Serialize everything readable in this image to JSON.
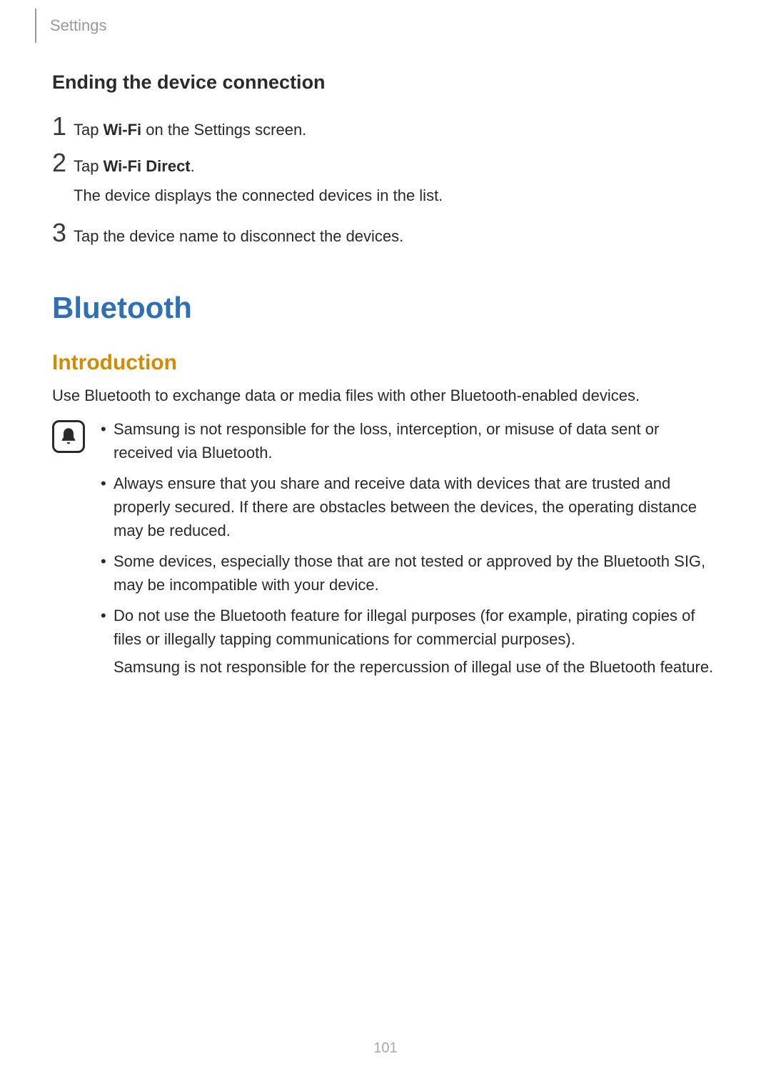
{
  "header": {
    "section": "Settings"
  },
  "subheading": "Ending the device connection",
  "steps": [
    {
      "num": "1",
      "pre": "Tap ",
      "bold": "Wi-Fi",
      "post": " on the Settings screen.",
      "sub": ""
    },
    {
      "num": "2",
      "pre": "Tap ",
      "bold": "Wi-Fi Direct",
      "post": ".",
      "sub": "The device displays the connected devices in the list."
    },
    {
      "num": "3",
      "pre": "Tap the device name to disconnect the devices.",
      "bold": "",
      "post": "",
      "sub": ""
    }
  ],
  "sectionTitle": "Bluetooth",
  "subsectionTitle": "Introduction",
  "introPara": "Use Bluetooth to exchange data or media files with other Bluetooth-enabled devices.",
  "notes": [
    {
      "text": "Samsung is not responsible for the loss, interception, or misuse of data sent or received via Bluetooth.",
      "extra": ""
    },
    {
      "text": "Always ensure that you share and receive data with devices that are trusted and properly secured. If there are obstacles between the devices, the operating distance may be reduced.",
      "extra": ""
    },
    {
      "text": "Some devices, especially those that are not tested or approved by the Bluetooth SIG, may be incompatible with your device.",
      "extra": ""
    },
    {
      "text": "Do not use the Bluetooth feature for illegal purposes (for example, pirating copies of files or illegally tapping communications for commercial purposes).",
      "extra": "Samsung is not responsible for the repercussion of illegal use of the Bluetooth feature."
    }
  ],
  "pageNumber": "101"
}
